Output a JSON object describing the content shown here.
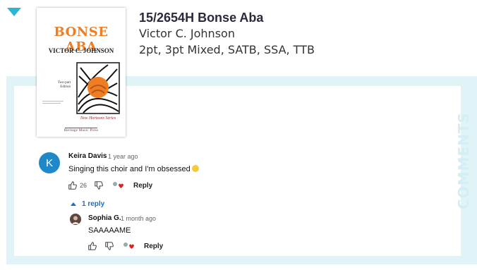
{
  "product": {
    "title": "15/2654H Bonse Aba",
    "composer": "Victor C. Johnson",
    "voicings": "2pt, 3pt Mixed, SATB, SSA, TTB"
  },
  "cover": {
    "title": "BONSE ABA",
    "composer": "VICTOR C. JOHNSON",
    "edition_line1": "Two-part",
    "edition_line2": "Edition",
    "series": "New Horizons Series",
    "publisher": "Heritage Music Press"
  },
  "comments_label": "COMMENTS",
  "comment": {
    "author": "Keira Davis",
    "time": "1 year ago",
    "text": "Singing this choir and I'm obsessed",
    "avatar_letter": "K",
    "like_count": "26",
    "reply_label": "Reply"
  },
  "replies_toggle": "1 reply",
  "reply": {
    "author": "Sophia G.",
    "time": "1 month ago",
    "text": "SAAAAAME",
    "reply_label": "Reply"
  },
  "colors": {
    "accent": "#2bb6d6",
    "panel_bg": "#e0f4f8",
    "cover_orange": "#ef7d23",
    "link_blue": "#1a6fc4",
    "avatar_blue": "#1e88c9"
  },
  "icons": [
    "caret-down-icon",
    "thumbs-up-icon",
    "thumbs-down-icon",
    "creator-heart-icon",
    "caret-up-icon",
    "grinning-emoji-icon"
  ]
}
